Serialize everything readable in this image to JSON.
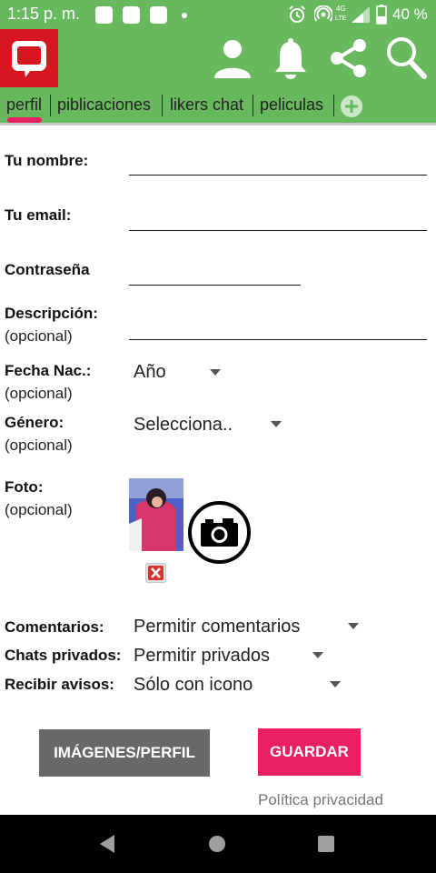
{
  "status_bar": {
    "time": "1:15 p. m.",
    "battery_text": "40 %",
    "icons": [
      "notification-icon",
      "notification-icon",
      "notification-icon",
      "dot-icon",
      "alarm-icon",
      "hotspot-icon",
      "4g-lte-icon",
      "signal-icon",
      "battery-icon"
    ]
  },
  "app_bar": {
    "icons": [
      "app-logo-chat-icon",
      "profile-icon",
      "bell-icon",
      "share-icon",
      "search-icon"
    ]
  },
  "tabs": [
    {
      "label": "perfil",
      "active": true
    },
    {
      "label": "piblicaciones",
      "active": false
    },
    {
      "label": "likers chat",
      "active": false
    },
    {
      "label": "peliculas",
      "active": false
    }
  ],
  "form": {
    "name_label": "Tu nombre:",
    "email_label": "Tu email:",
    "password_label": "Contraseña",
    "description_label": "Descripción:",
    "description_optional": "(opcional)",
    "birthdate_label": "Fecha Nac.:",
    "birthdate_optional": "(opcional)",
    "birthdate_value": "Año",
    "gender_label": "Género:",
    "gender_optional": "(opcional)",
    "gender_value": "Selecciona..",
    "photo_label": "Foto:",
    "photo_optional": "(opcional)",
    "comments_label": "Comentarios:",
    "comments_value": "Permitir comentarios",
    "private_chats_label": "Chats privados:",
    "private_chats_value": "Permitir privados",
    "notices_label": "Recibir avisos:",
    "notices_value": "Sólo con icono"
  },
  "buttons": {
    "images_profile": "IMÁGENES/PERFIL",
    "save": "GUARDAR"
  },
  "privacy_link": "Política privacidad",
  "colors": {
    "header_green": "#68b85e",
    "logo_red": "#d6171f",
    "accent_pink": "#e91e63",
    "button_gray": "#686868"
  }
}
